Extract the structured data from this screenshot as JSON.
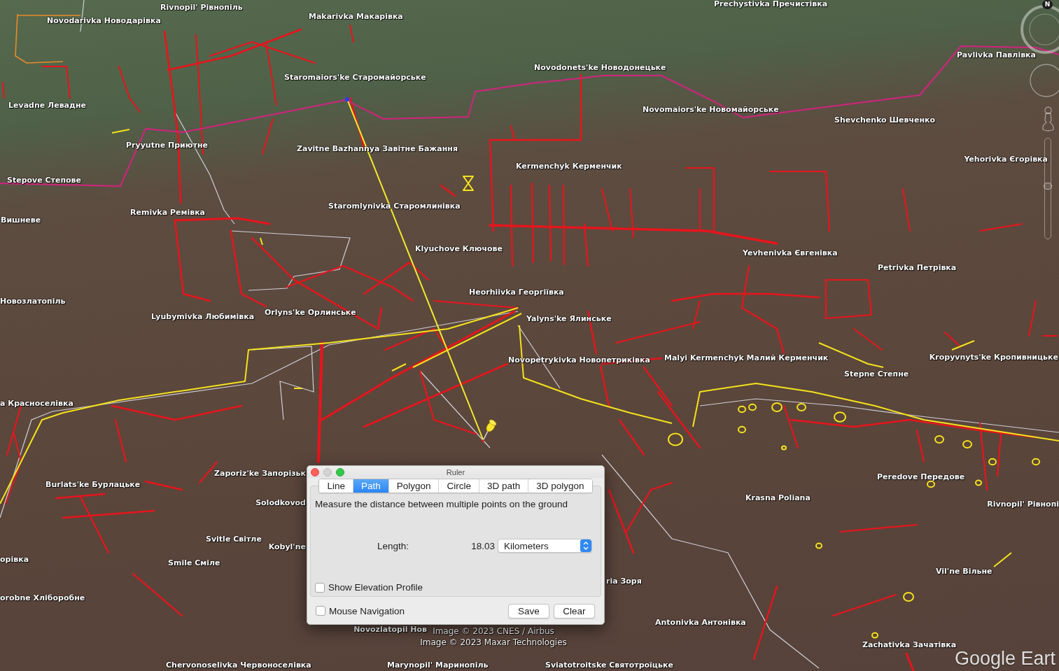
{
  "map": {
    "place_labels": [
      "Rivnopil' Рівнопіль",
      "Prechystivka Пречистівка",
      "Novodarivka Новодарівка",
      "Makarivka Макарівка",
      "Pavlivka Павлівка",
      "Novodonets'ke Новодонецьке",
      "Staromaiors'ke Старомайорське",
      "Levadne Левадне",
      "Novomaiors'ke Новомайорське",
      "Shevchenko Шевченко",
      "Pryyutne Приютне",
      "Zavitne Bazhannya Завітне Бажання",
      "Kermenchyk Керменчик",
      "Yehorivka Єгорівка",
      "Stepove Степове",
      "Вишневе",
      "Remivka Ремівка",
      "Staromlynivka Старомлинівка",
      "Klyuchove Ключове",
      "Yevhenivka Євгенівка",
      "Petrivka Петрівка",
      "Новозлатопіль",
      "Heorhiivka Георгіївка",
      "Lyubymivka Любимівка",
      "Orlyns'ke Орлинське",
      "Yalyns'ke Ялинське",
      "Novopetrykivka Новопетриківка",
      "Malyi Kermenchyk Малий Керменчик",
      "Kropyvnyts'ke Кропивницьке",
      "Stepne Степне",
      "a Красноселівка",
      "Zaporiz'ke Запорізьк",
      "Burlats'ke Бурлацьке",
      "Peredove Передове",
      "Solodkovod",
      "Krasna Poliana",
      "Rivnopil' Рівнопі",
      "Svitle Світле",
      "Kobyl'ne",
      "орівка",
      "Smile Сміле",
      "Vil'ne Вільне",
      "ria Зоря",
      "orobne Хліборобне",
      "Novozlatopil Нов",
      "Antonivka Антонівка",
      "Zachativka Зачатівка",
      "Chervonoselivka Червоноселівка",
      "Marynopil' Маринопіль",
      "Sviatotroitske Святотроїцьке"
    ],
    "attribution": [
      "Image © 2023 CNES / Airbus",
      "Image © 2023 Maxar Technologies"
    ],
    "logo": "Google Eart"
  },
  "navigation": {
    "north_label": "N",
    "zoom_slider": {
      "level": 0.52
    }
  },
  "ruler_dialog": {
    "title": "Ruler",
    "minimize_disabled": true,
    "tabs": [
      {
        "label": "Line",
        "selected": false
      },
      {
        "label": "Path",
        "selected": true
      },
      {
        "label": "Polygon",
        "selected": false
      },
      {
        "label": "Circle",
        "selected": false
      },
      {
        "label": "3D path",
        "selected": false
      },
      {
        "label": "3D polygon",
        "selected": false
      }
    ],
    "description": "Measure the distance between multiple points on the ground",
    "length": {
      "label": "Length:",
      "value": "18.03",
      "unit": "Kilometers"
    },
    "show_elevation_profile": {
      "label": "Show Elevation Profile",
      "checked": false
    },
    "mouse_navigation": {
      "label": "Mouse Navigation",
      "checked": false
    },
    "buttons": [
      "Save",
      "Clear"
    ]
  }
}
